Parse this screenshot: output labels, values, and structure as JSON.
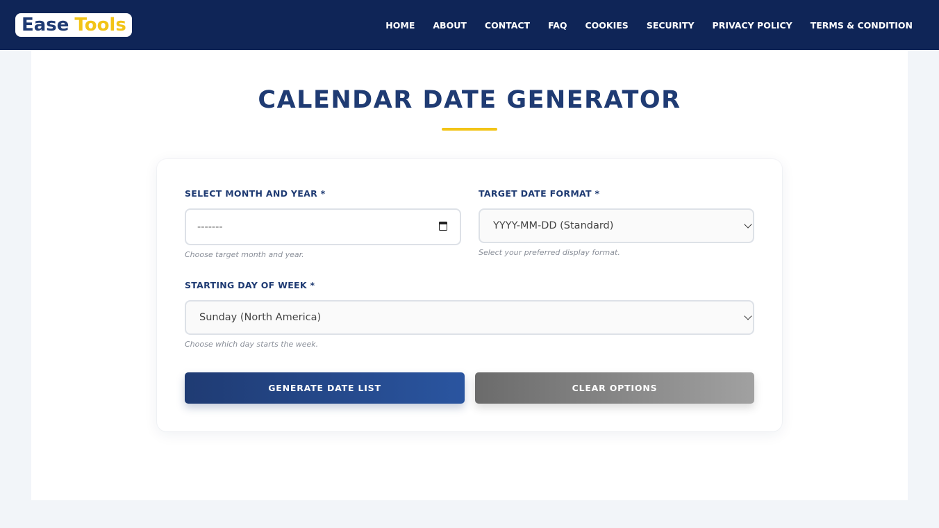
{
  "header": {
    "logo": {
      "word1": "Ease",
      "word2": "Tools"
    },
    "nav": [
      {
        "label": "HOME"
      },
      {
        "label": "ABOUT"
      },
      {
        "label": "CONTACT"
      },
      {
        "label": "FAQ"
      },
      {
        "label": "COOKIES"
      },
      {
        "label": "SECURITY"
      },
      {
        "label": "PRIVACY POLICY"
      },
      {
        "label": "TERMS & CONDITION"
      }
    ]
  },
  "page": {
    "title": "CALENDAR DATE GENERATOR"
  },
  "form": {
    "month_year": {
      "label": "SELECT MONTH AND YEAR *",
      "value": "-------",
      "hint": "Choose target month and year.",
      "icon": "calendar-icon"
    },
    "date_format": {
      "label": "TARGET DATE FORMAT *",
      "selected": "YYYY-MM-DD (Standard)",
      "hint": "Select your preferred display format.",
      "icon": "chevron-down-icon"
    },
    "start_day": {
      "label": "STARTING DAY OF WEEK *",
      "selected": "Sunday (North America)",
      "hint": "Choose which day starts the week.",
      "icon": "chevron-down-icon"
    },
    "generate_label": "GENERATE DATE LIST",
    "clear_label": "CLEAR OPTIONS"
  },
  "colors": {
    "navy": "#0f2557",
    "brand_blue": "#1f3b73",
    "accent_yellow": "#f2c417",
    "button_gray": "#7a7a7a"
  }
}
